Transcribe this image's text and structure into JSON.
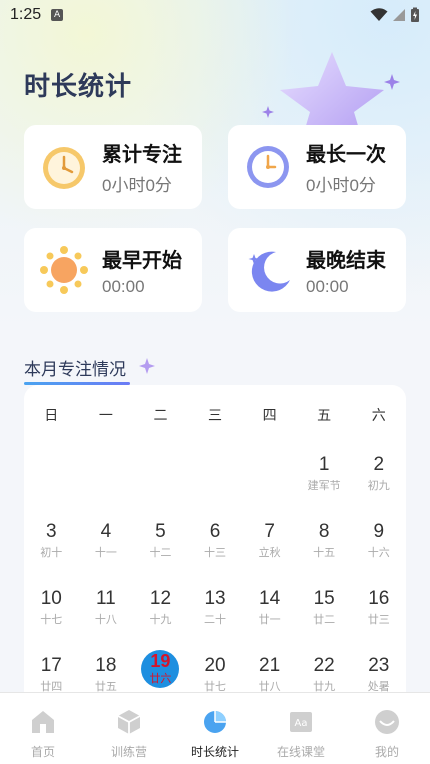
{
  "status_bar": {
    "time": "1:25",
    "notification": "A"
  },
  "page_title": "时长统计",
  "stats": [
    {
      "title": "累计专注",
      "value": "0小时0分",
      "icon": "alarm-clock-icon"
    },
    {
      "title": "最长一次",
      "value": "0小时0分",
      "icon": "clock-icon"
    },
    {
      "title": "最早开始",
      "value": "00:00",
      "icon": "sun-icon"
    },
    {
      "title": "最晚结束",
      "value": "00:00",
      "icon": "moon-icon"
    }
  ],
  "section_title": "本月专注情况",
  "calendar": {
    "weekdays": [
      "日",
      "一",
      "二",
      "三",
      "四",
      "五",
      "六"
    ],
    "weeks": [
      [
        null,
        null,
        null,
        null,
        null,
        {
          "day": "1",
          "lunar": "建军节"
        },
        {
          "day": "2",
          "lunar": "初九"
        }
      ],
      [
        {
          "day": "3",
          "lunar": "初十"
        },
        {
          "day": "4",
          "lunar": "十一"
        },
        {
          "day": "5",
          "lunar": "十二"
        },
        {
          "day": "6",
          "lunar": "十三"
        },
        {
          "day": "7",
          "lunar": "立秋"
        },
        {
          "day": "8",
          "lunar": "十五"
        },
        {
          "day": "9",
          "lunar": "十六"
        }
      ],
      [
        {
          "day": "10",
          "lunar": "十七"
        },
        {
          "day": "11",
          "lunar": "十八"
        },
        {
          "day": "12",
          "lunar": "十九"
        },
        {
          "day": "13",
          "lunar": "二十"
        },
        {
          "day": "14",
          "lunar": "廿一"
        },
        {
          "day": "15",
          "lunar": "廿二"
        },
        {
          "day": "16",
          "lunar": "廿三"
        }
      ],
      [
        {
          "day": "17",
          "lunar": "廿四"
        },
        {
          "day": "18",
          "lunar": "廿五"
        },
        {
          "day": "19",
          "lunar": "廿六",
          "today": true
        },
        {
          "day": "20",
          "lunar": "廿七"
        },
        {
          "day": "21",
          "lunar": "廿八"
        },
        {
          "day": "22",
          "lunar": "廿九"
        },
        {
          "day": "23",
          "lunar": "处暑"
        }
      ]
    ],
    "today_color": "#1e8fe0"
  },
  "tabs": [
    {
      "label": "首页",
      "icon": "home-icon"
    },
    {
      "label": "训练营",
      "icon": "cube-icon"
    },
    {
      "label": "时长统计",
      "icon": "pie-chart-icon",
      "active": true
    },
    {
      "label": "在线课堂",
      "icon": "classroom-icon"
    },
    {
      "label": "我的",
      "icon": "profile-icon"
    }
  ]
}
